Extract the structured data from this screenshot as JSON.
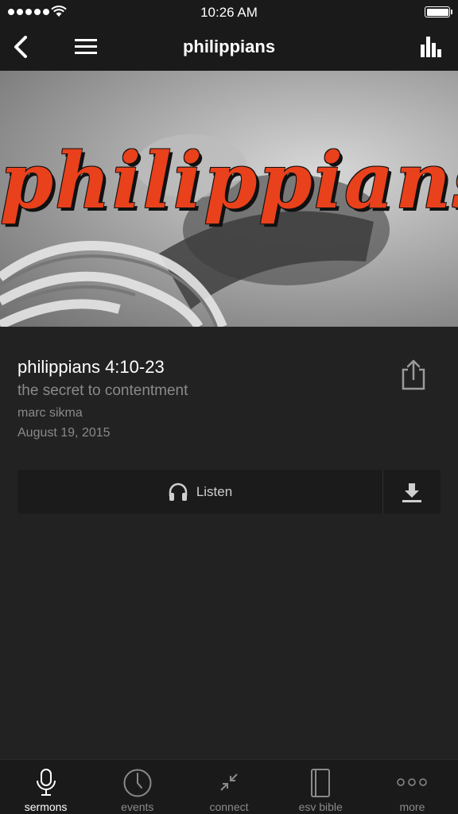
{
  "status_bar": {
    "time": "10:26 AM"
  },
  "nav": {
    "title": "philippians"
  },
  "hero": {
    "title": "philippians"
  },
  "sermon": {
    "title": "philippians 4:10-23",
    "subtitle": "the secret to contentment",
    "speaker": "marc sikma",
    "date": "August 19, 2015"
  },
  "actions": {
    "listen_label": "Listen"
  },
  "tabs": [
    {
      "label": "sermons",
      "icon": "microphone-icon",
      "active": true
    },
    {
      "label": "events",
      "icon": "clock-icon"
    },
    {
      "label": "connect",
      "icon": "connect-arrows-icon"
    },
    {
      "label": "esv bible",
      "icon": "book-icon"
    },
    {
      "label": "more",
      "icon": "more-dots-icon"
    }
  ],
  "colors": {
    "accent": "#e8411c",
    "background": "#222222",
    "bar": "#1a1a1a",
    "muted_text": "#8a8a8a"
  }
}
